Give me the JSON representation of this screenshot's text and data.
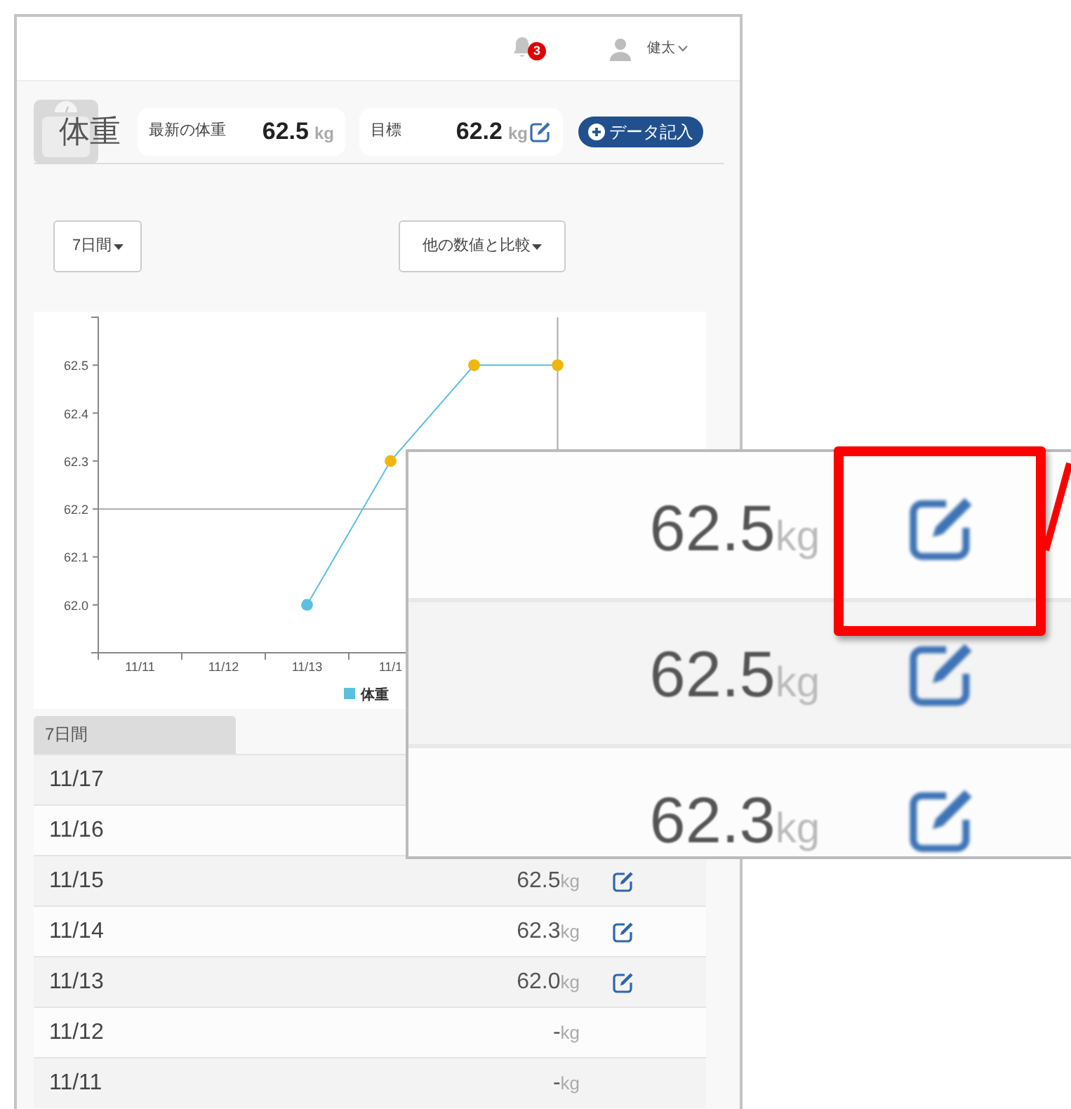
{
  "header": {
    "notification_count": "3",
    "user_name": "健太"
  },
  "title": "体重",
  "latest": {
    "label": "最新の体重",
    "value": "62.5",
    "unit": "kg"
  },
  "goal": {
    "label": "目標",
    "value": "62.2",
    "unit": "kg"
  },
  "add_button": "データ記入",
  "period_dropdown": "7日間",
  "compare_dropdown": "他の数値と比較",
  "chart_data": {
    "type": "line",
    "categories": [
      "11/11",
      "11/12",
      "11/13",
      "11/1",
      null,
      null,
      null
    ],
    "series": [
      {
        "name": "体重",
        "color": "#5bc0de",
        "marker": "circle",
        "values": [
          null,
          null,
          62.0,
          62.3,
          62.5,
          62.5,
          null
        ]
      }
    ],
    "ylim": [
      61.9,
      62.6
    ],
    "yticks": [
      {
        "value": 62,
        "label": "62.0"
      },
      62.1,
      62.2,
      62.3,
      62.4,
      62.5
    ]
  },
  "table": {
    "tab": "7日間",
    "rows": [
      {
        "date": "11/17"
      },
      {
        "date": "11/16"
      },
      {
        "date": "11/15",
        "value": "62.5",
        "unit": "kg",
        "editable": true
      },
      {
        "date": "11/14",
        "value": "62.3",
        "unit": "kg",
        "editable": true
      },
      {
        "date": "11/13",
        "value": "62.0",
        "unit": "kg",
        "editable": true
      },
      {
        "date": "11/12",
        "value": "-",
        "unit": "kg",
        "editable": false
      },
      {
        "date": "11/11",
        "value": "-",
        "unit": "kg",
        "editable": false
      }
    ]
  },
  "zoom_callout": {
    "rows": [
      {
        "value": "62.5",
        "unit": "kg",
        "editable": true
      },
      {
        "value": "62.5",
        "unit": "kg",
        "editable": true
      },
      {
        "value": "62.3",
        "unit": "kg",
        "editable": true
      }
    ]
  }
}
